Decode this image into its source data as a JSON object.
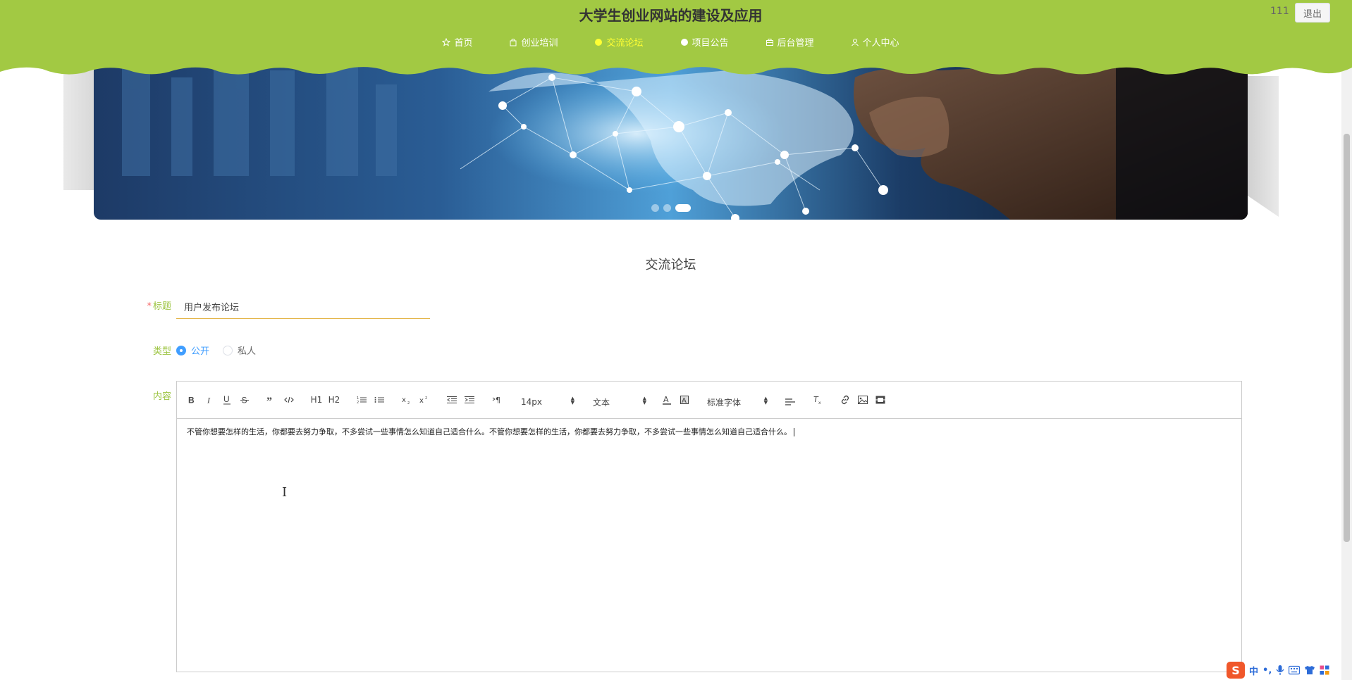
{
  "header": {
    "site_title": "大学生创业网站的建设及应用",
    "user_name": "111",
    "logout_label": "退出",
    "bg_color": "#a2c943",
    "nav": [
      {
        "label": "首页",
        "icon": "star-icon",
        "active": false
      },
      {
        "label": "创业培训",
        "icon": "bag-icon",
        "active": false
      },
      {
        "label": "交流论坛",
        "icon": "dot-icon",
        "active": true
      },
      {
        "label": "项目公告",
        "icon": "dot-icon",
        "active": false
      },
      {
        "label": "后台管理",
        "icon": "briefcase-icon",
        "active": false
      },
      {
        "label": "个人中心",
        "icon": "user-icon",
        "active": false
      }
    ]
  },
  "banner": {
    "slide_count": 3,
    "active_slide": 3
  },
  "form": {
    "section_title": "交流论坛",
    "title_label": "标题",
    "title_required_mark": "*",
    "title_value": "用户发布论坛",
    "type_label": "类型",
    "type_options": [
      "公开",
      "私人"
    ],
    "type_selected": "公开",
    "content_label": "内容",
    "toolbar": {
      "h1": "H1",
      "h2": "H2",
      "font_size": "14px",
      "header_select": "文本",
      "font_family": "标准字体"
    },
    "content_text": "不管你想要怎样的生活，你都要去努力争取，不多尝试一些事情怎么知道自己适合什么。不管你想要怎样的生活，你都要去努力争取，不多尝试一些事情怎么知道自己适合什么。"
  },
  "ime": {
    "logo": "S",
    "mode": "中"
  }
}
